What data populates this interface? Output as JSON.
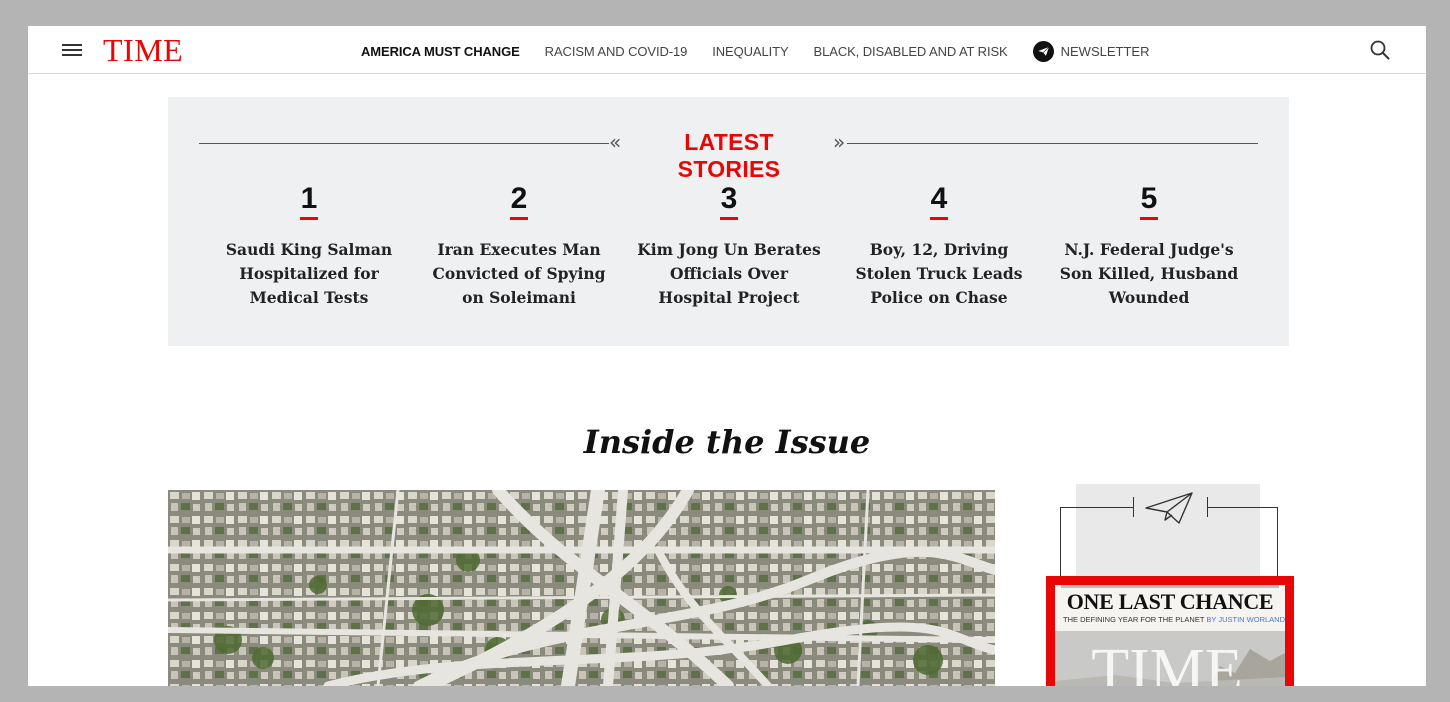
{
  "header": {
    "logo": "TIME",
    "nav": [
      {
        "label": "AMERICA MUST CHANGE",
        "active": true
      },
      {
        "label": "RACISM AND COVID-19",
        "active": false
      },
      {
        "label": "INEQUALITY",
        "active": false
      },
      {
        "label": "BLACK, DISABLED AND AT RISK",
        "active": false
      }
    ],
    "newsletter_label": "NEWSLETTER",
    "icons": {
      "menu": "hamburger-menu-icon",
      "newsletter": "paper-plane-icon",
      "search": "search-icon"
    }
  },
  "latest": {
    "title": "LATEST STORIES",
    "stories": [
      {
        "num": "1",
        "title": "Saudi King Salman Hospitalized for Medical Tests"
      },
      {
        "num": "2",
        "title": "Iran Executes Man Convicted of Spying on Soleimani"
      },
      {
        "num": "3",
        "title": "Kim Jong Un Berates Officials Over Hospital Project"
      },
      {
        "num": "4",
        "title": "Boy, 12, Driving Stolen Truck Leads Police on Chase"
      },
      {
        "num": "5",
        "title": "N.J. Federal Judge's Son Killed, Husband Wounded"
      }
    ]
  },
  "issue": {
    "heading": "Inside the Issue",
    "cover": {
      "headline": "ONE LAST CHANCE",
      "sub": "THE DEFINING YEAR FOR THE PLANET",
      "byline": "BY JUSTIN WORLAND",
      "masthead": "TIME"
    }
  },
  "colors": {
    "brand_red": "#e90606",
    "panel_gray": "#eff0f1",
    "page_frame": "#b4b4b4"
  }
}
